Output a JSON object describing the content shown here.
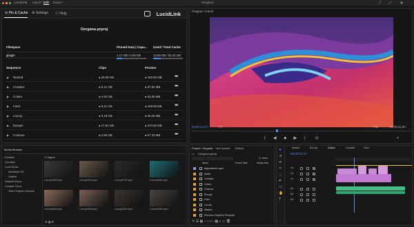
{
  "topbar": {
    "app": "LucidLink",
    "menu": [
      "Import",
      "Edit",
      "Export"
    ],
    "title": "Oergana"
  },
  "lucidlink": {
    "tabs": [
      {
        "label": "Pin & Cache"
      },
      {
        "label": "Settings"
      },
      {
        "label": "Help"
      }
    ],
    "logo": "LucidLink",
    "project_title": "Oergana.prproj",
    "fs_headers": {
      "filespace": "Filespace",
      "pinned": "Pinned Data | Capa...",
      "used": "Used / Total Cache"
    },
    "filespace": {
      "name": "gkagle",
      "pinned": "1.17 GB / 6.09 GB",
      "used": "13.69 GB / 52.43 GB",
      "pinned_fraction": 0.19,
      "used_fraction": 0.26
    },
    "seq_headers": {
      "sequence": "Sequence",
      "clips": "Clips",
      "proxies": "Proxies"
    },
    "sequences": [
      {
        "name": "Nested",
        "clips": "29.08 GB",
        "proxies": "160.55 MB"
      },
      {
        "name": "Creative",
        "clips": "5.21 GB",
        "proxies": "87.84 MB"
      },
      {
        "name": "Colors",
        "clips": "4.62 GB",
        "proxies": "93.05 MB"
      },
      {
        "name": "Farm",
        "clips": "9.21 GB",
        "proxies": "159.09 MB"
      },
      {
        "name": "Luxury",
        "clips": "3.18 GB",
        "proxies": "48.25 MB"
      },
      {
        "name": "Europe",
        "clips": "17.61 GB",
        "proxies": "370.30 MB"
      },
      {
        "name": "Cosmos",
        "clips": "3.86 GB",
        "proxies": "57.33 MB"
      }
    ]
  },
  "program": {
    "title": "Program: Colors",
    "tc_left": "00:00:13:17",
    "fit": "Fit",
    "tc_right": "00:00:41:00",
    "quality": "Full"
  },
  "media_browser": {
    "title": "Media Browser",
    "path": "Creative",
    "ingest": "Ingest",
    "tree": [
      "Favorites",
      "Local Drives",
      "Macintosh HD",
      "Untitled",
      "Network Drives",
      "Creative Cloud",
      "Team Projects Versions"
    ],
    "thumbs": [
      {
        "label": "Luxury0105.mp4",
        "color": "#3b3b3b"
      },
      {
        "label": "Luxury0140.mp4",
        "color": "#6c5a4a"
      },
      {
        "label": "Luxury0175.mp4",
        "color": "#2b2b2b"
      },
      {
        "label": "Luxury0180.mp4",
        "color": "#1f6d78"
      },
      {
        "label": "Luxury0265.mp4",
        "color": "#8a6a5a"
      },
      {
        "label": "Luxury0308.mp4",
        "color": "#7a5f55"
      },
      {
        "label": "Luxury0312.mp4",
        "color": "#3c3530"
      },
      {
        "label": "Luxury0335.mp4",
        "color": "#4a4440"
      }
    ]
  },
  "project": {
    "tabs": [
      "Project: Oergana",
      "Info Screen",
      "Effects"
    ],
    "file": "Oergana.prproj",
    "count": "21 Items",
    "cols": [
      "Name",
      "Frame Rate",
      "Media Start"
    ],
    "items": [
      {
        "name": "Adjustment Layer",
        "color": "#9e8bd0"
      },
      {
        "name": "Audio",
        "color": "#e0a13a"
      },
      {
        "name": "Creative",
        "color": "#e0a13a"
      },
      {
        "name": "Colors",
        "color": "#e0a13a"
      },
      {
        "name": "Cosmos",
        "color": "#e0a13a"
      },
      {
        "name": "Europe",
        "color": "#e0a13a"
      },
      {
        "name": "Farm",
        "color": "#e0a13a"
      },
      {
        "name": "Luxury",
        "color": "#e0a13a"
      },
      {
        "name": "Nested",
        "color": "#e0a13a"
      },
      {
        "name": "Remove Graphics Template",
        "color": "#e0a13a"
      }
    ]
  },
  "timeline": {
    "tabs": [
      "Nested",
      "Europe",
      "Colors",
      "Creative",
      "Farm"
    ],
    "timecode": "00:00:13:17"
  }
}
